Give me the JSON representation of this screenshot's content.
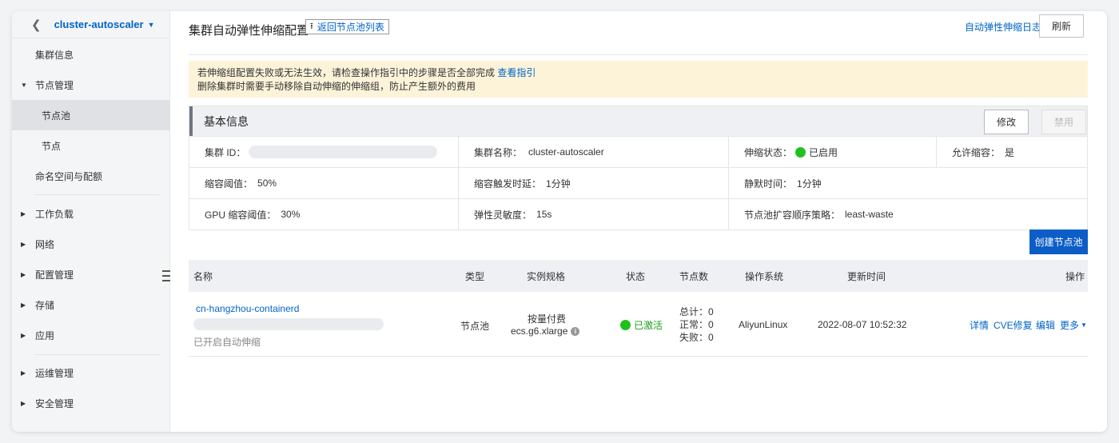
{
  "sidebar": {
    "cluster_name": "cluster-autoscaler",
    "items": [
      {
        "label": "集群信息"
      },
      {
        "label": "节点管理"
      },
      {
        "label": "节点池"
      },
      {
        "label": "节点"
      },
      {
        "label": "命名空间与配额"
      },
      {
        "label": "工作负载"
      },
      {
        "label": "网络"
      },
      {
        "label": "配置管理"
      },
      {
        "label": "存储"
      },
      {
        "label": "应用"
      },
      {
        "label": "运维管理"
      },
      {
        "label": "安全管理"
      }
    ]
  },
  "header": {
    "title": "集群自动弹性伸缩配置",
    "back_link": "返回节点池列表",
    "log_link": "自动弹性伸缩日志",
    "refresh": "刷新"
  },
  "notice": {
    "line1": "若伸缩组配置失败或无法生效，请检查操作指引中的步骤是否全部完成",
    "line1_link": "查看指引",
    "line2": "删除集群时需要手动移除自动伸缩的伸缩组，防止产生额外的费用"
  },
  "basic_info": {
    "heading": "基本信息",
    "edit": "修改",
    "disable": "禁用",
    "cluster_id_label": "集群 ID：",
    "cluster_name_label": "集群名称：",
    "cluster_name_value": "cluster-autoscaler",
    "scaling_status_label": "伸缩状态：",
    "scaling_status_value": "已启用",
    "allow_scale_in_label": "允许缩容：",
    "allow_scale_in_value": "是",
    "scale_in_threshold_label": "缩容阈值：",
    "scale_in_threshold_value": "50%",
    "scale_in_delay_label": "缩容触发时延：",
    "scale_in_delay_value": "1分钟",
    "cooldown_label": "静默时间：",
    "cooldown_value": "1分钟",
    "gpu_threshold_label": "GPU 缩容阈值：",
    "gpu_threshold_value": "30%",
    "sensitivity_label": "弹性灵敏度：",
    "sensitivity_value": "15s",
    "expander_label": "节点池扩容顺序策略：",
    "expander_value": "least-waste"
  },
  "create_button": "创建节点池",
  "table": {
    "headers": {
      "name": "名称",
      "type": "类型",
      "spec": "实例规格",
      "status": "状态",
      "nodes": "节点数",
      "os": "操作系统",
      "updated": "更新时间",
      "actions": "操作"
    },
    "rows": [
      {
        "name": "cn-hangzhou-containerd",
        "autoscale_note": "已开启自动伸缩",
        "type": "节点池",
        "billing": "按量付费",
        "instance_type": "ecs.g6.xlarge",
        "status": "已激活",
        "nodes_total": "总计：0",
        "nodes_normal": "正常：0",
        "nodes_failed": "失败：0",
        "os": "AliyunLinux",
        "updated": "2022-08-07 10:52:32",
        "action_detail": "详情",
        "action_cve": "CVE修复",
        "action_edit": "编辑",
        "action_more": "更多"
      }
    ]
  },
  "colors": {
    "link": "#0064c8",
    "primary": "#0d5dc7",
    "active_green": "#1fc11f",
    "notice_bg": "#fdf3d9"
  }
}
